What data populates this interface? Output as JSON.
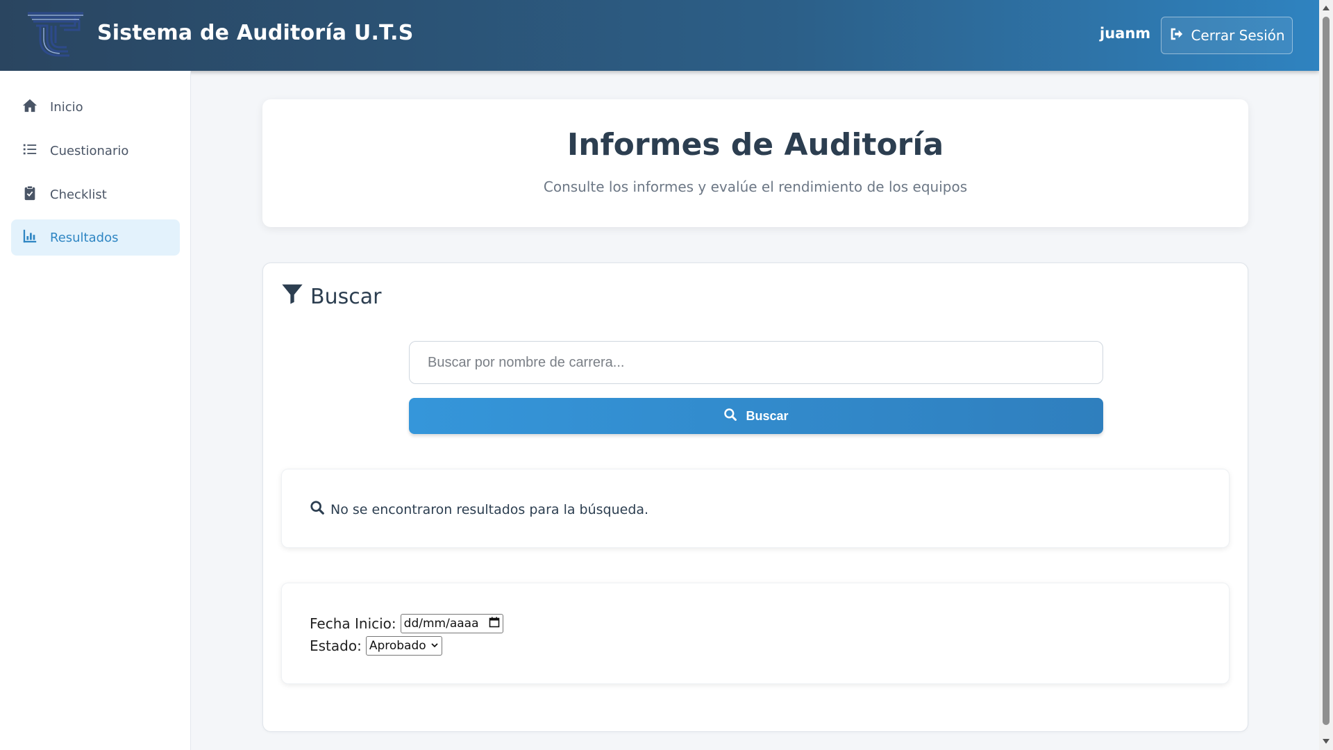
{
  "header": {
    "title": "Sistema de Auditoría U.T.S",
    "username": "juanm",
    "logout_label": "Cerrar Sesión",
    "logo_icon": "uts-logo-icon"
  },
  "sidebar": {
    "items": [
      {
        "label": "Inicio",
        "icon": "home-icon",
        "active": false
      },
      {
        "label": "Cuestionario",
        "icon": "list-icon",
        "active": false
      },
      {
        "label": "Checklist",
        "icon": "clipboard-check-icon",
        "active": false
      },
      {
        "label": "Resultados",
        "icon": "bar-chart-icon",
        "active": true
      }
    ]
  },
  "hero": {
    "title": "Informes de Auditoría",
    "subtitle": "Consulte los informes y evalúe el rendimiento de los equipos"
  },
  "search": {
    "heading": "Buscar",
    "placeholder": "Buscar por nombre de carrera...",
    "button_label": "Buscar",
    "empty_message": "No se encontraron resultados para la búsqueda."
  },
  "filters": {
    "date_label": "Fecha Inicio:",
    "date_placeholder": "dd/mm/aaaa",
    "status_label": "Estado:",
    "status_selected": "Aprobado"
  },
  "colors": {
    "header_start": "#2a4560",
    "header_end": "#2f83c0",
    "accent": "#2f86c3",
    "active_bg": "#e3f2fc"
  }
}
